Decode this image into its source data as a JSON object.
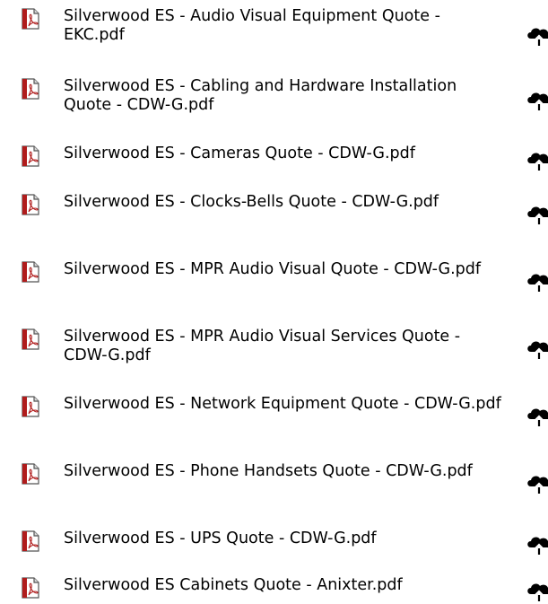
{
  "files": [
    {
      "name": "Silverwood ES - Audio Visual Equipment Quote - EKC.pdf",
      "icon": "pdf-file-icon",
      "action_icon": "cloud-upload-icon"
    },
    {
      "name": "Silverwood ES - Cabling and Hardware Installation Quote - CDW-G.pdf",
      "icon": "pdf-file-icon",
      "action_icon": "cloud-upload-icon"
    },
    {
      "name": "Silverwood ES - Cameras Quote - CDW-G.pdf",
      "icon": "pdf-file-icon",
      "action_icon": "cloud-upload-icon"
    },
    {
      "name": "Silverwood ES - Clocks-Bells Quote - CDW-G.pdf",
      "icon": "pdf-file-icon",
      "action_icon": "cloud-upload-icon"
    },
    {
      "name": "Silverwood ES - MPR Audio Visual Quote - CDW-G.pdf",
      "icon": "pdf-file-icon",
      "action_icon": "cloud-upload-icon"
    },
    {
      "name": "Silverwood ES - MPR Audio Visual Services Quote - CDW-G.pdf",
      "icon": "pdf-file-icon",
      "action_icon": "cloud-upload-icon"
    },
    {
      "name": "Silverwood ES - Network Equipment Quote - CDW-G.pdf",
      "icon": "pdf-file-icon",
      "action_icon": "cloud-upload-icon"
    },
    {
      "name": "Silverwood ES - Phone Handsets Quote - CDW-G.pdf",
      "icon": "pdf-file-icon",
      "action_icon": "cloud-upload-icon"
    },
    {
      "name": "Silverwood ES - UPS Quote - CDW-G.pdf",
      "icon": "pdf-file-icon",
      "action_icon": "cloud-upload-icon"
    },
    {
      "name": "Silverwood ES Cabinets Quote - Anixter.pdf",
      "icon": "pdf-file-icon",
      "action_icon": "cloud-upload-icon"
    }
  ],
  "colors": {
    "text": "#000000",
    "icon_red": "#b01c1c",
    "upload_icon": "#000000"
  }
}
